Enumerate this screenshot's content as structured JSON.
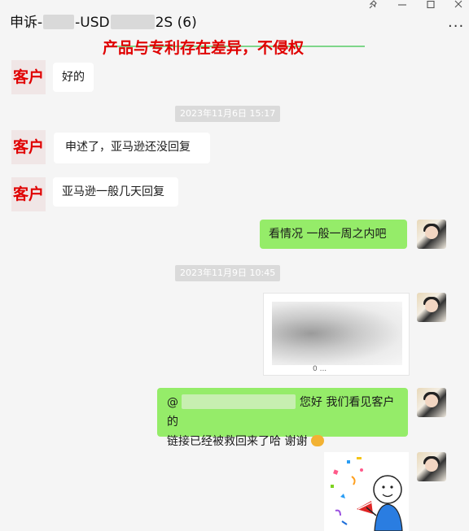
{
  "window": {
    "title_prefix": "申诉-",
    "title_middle": "-USD",
    "title_suffix": "2S (6)",
    "more_label": "···"
  },
  "banner": {
    "text": "产品与专利存在差异，不侵权"
  },
  "messages": [
    {
      "side": "left",
      "sender": "客户",
      "text": "好的"
    },
    {
      "side": "left",
      "sender": "客户",
      "text": "申述了，亚马逊还没回复"
    },
    {
      "side": "left",
      "sender": "客户",
      "text": "亚马逊一般几天回复"
    },
    {
      "side": "right",
      "text": "看情况 一般一周之内吧"
    },
    {
      "side": "right",
      "image_caption": "0 ..."
    },
    {
      "side": "right",
      "mention": "@",
      "line1": "您好 我们看见客户的",
      "line2": "链接已经被救回来了哈 谢谢"
    }
  ],
  "timestamps": [
    "2023年11月6日 15:17",
    "2023年11月9日 10:45"
  ],
  "icons": {
    "pin": "pin-icon",
    "minimize": "minimize-icon",
    "maximize": "maximize-icon",
    "close": "close-icon",
    "handshake": "handshake-emoji-icon",
    "sticker": "celebration-sticker-icon"
  }
}
